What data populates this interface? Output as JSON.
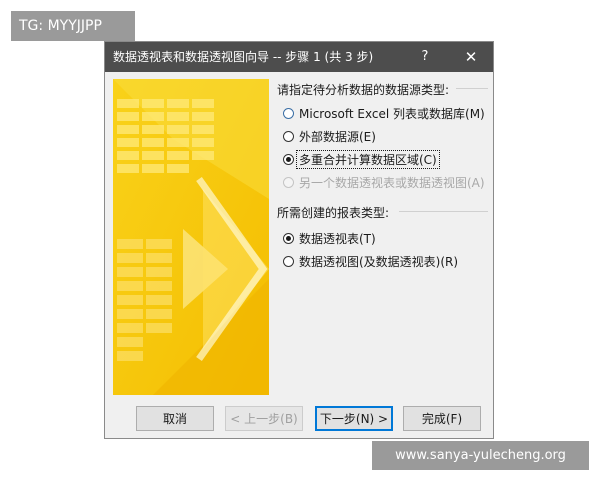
{
  "watermark_top": "TG: MYYJJPP",
  "watermark_bottom": "www.sanya-yulecheng.org",
  "dialog": {
    "title": "数据透视表和数据透视图向导 -- 步骤 1 (共 3 步)",
    "help_label": "?",
    "close_label": "✕",
    "source_section_label": "请指定待分析数据的数据源类型:",
    "source_options": [
      {
        "label": "Microsoft Excel 列表或数据库(M)",
        "checked": false,
        "enabled": true
      },
      {
        "label": "外部数据源(E)",
        "checked": false,
        "enabled": true
      },
      {
        "label": "多重合并计算数据区域(C)",
        "checked": true,
        "enabled": true
      },
      {
        "label": "另一个数据透视表或数据透视图(A)",
        "checked": false,
        "enabled": false
      }
    ],
    "report_section_label": "所需创建的报表类型:",
    "report_options": [
      {
        "label": "数据透视表(T)",
        "checked": true,
        "enabled": true
      },
      {
        "label": "数据透视图(及数据透视表)(R)",
        "checked": false,
        "enabled": true
      }
    ],
    "buttons": {
      "cancel": "取消",
      "back": "< 上一步(B)",
      "next": "下一步(N) >",
      "finish": "完成(F)"
    }
  },
  "colors": {
    "titlebar": "#4d4d4d",
    "illustration_yellow": "#f7c600",
    "accent_border": "#0078d7"
  }
}
